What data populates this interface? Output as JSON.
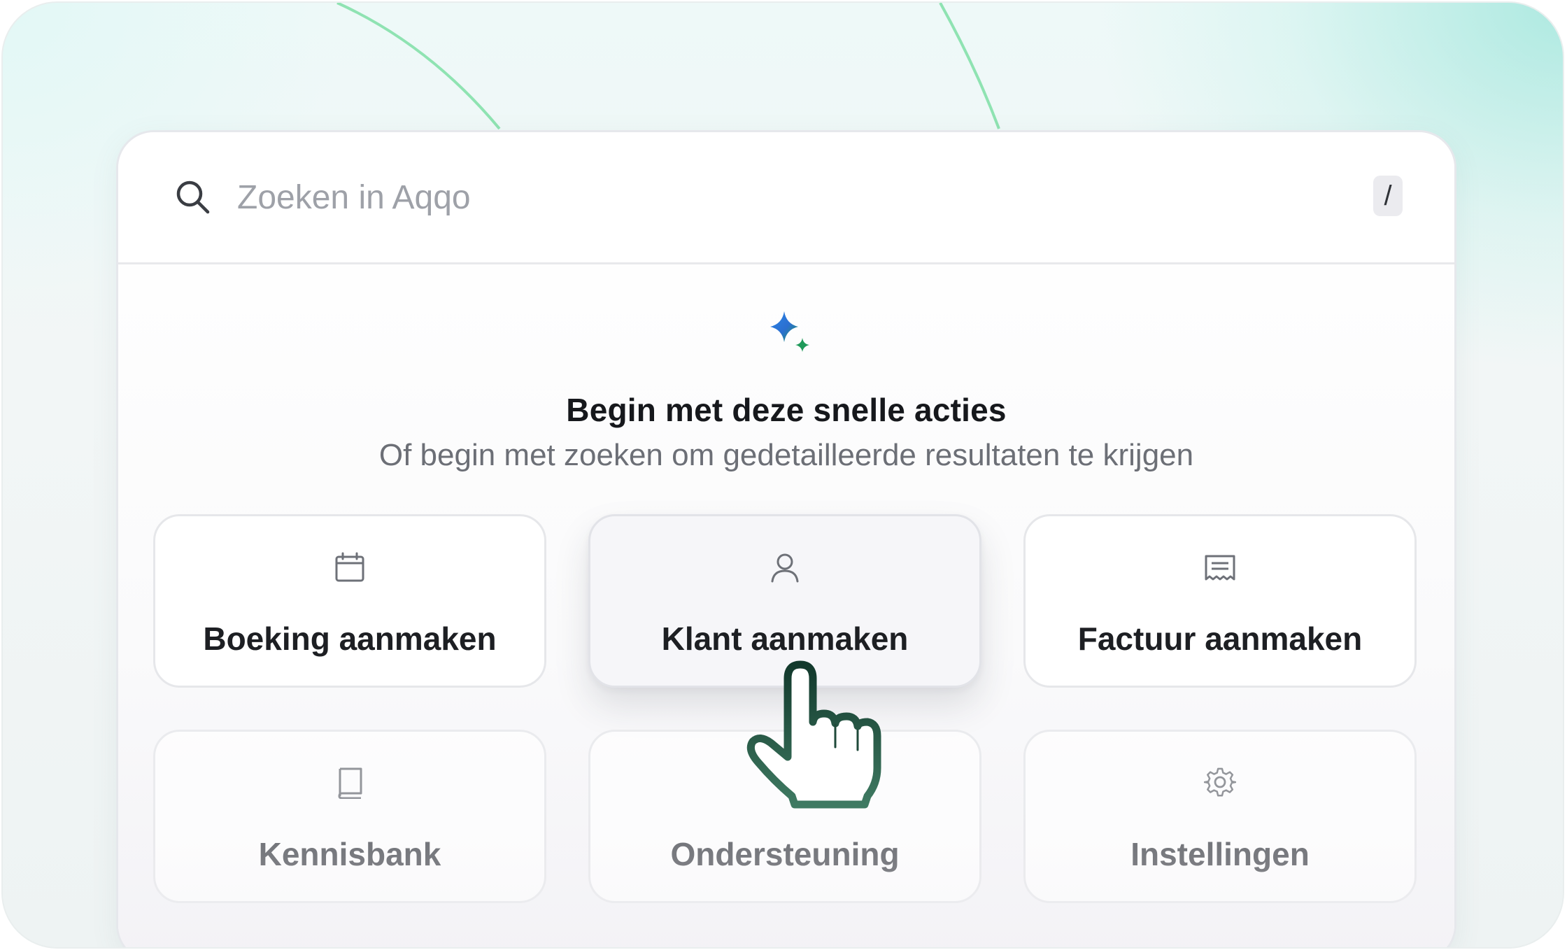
{
  "search": {
    "placeholder": "Zoeken in Aqqo",
    "shortcut": "/"
  },
  "empty_state": {
    "icon": "sparkle-icon",
    "title": "Begin met deze snelle acties",
    "subtitle": "Of begin met zoeken om gedetailleerde resultaten te krijgen"
  },
  "quick_actions": [
    {
      "label": "Boeking aanmaken",
      "icon": "calendar-icon",
      "state": "default"
    },
    {
      "label": "Klant aanmaken",
      "icon": "user-icon",
      "state": "hover"
    },
    {
      "label": "Factuur aanmaken",
      "icon": "receipt-icon",
      "state": "default"
    },
    {
      "label": "Kennisbank",
      "icon": "book-icon",
      "state": "muted"
    },
    {
      "label": "Ondersteuning",
      "icon": "support-icon",
      "state": "muted"
    },
    {
      "label": "Instellingen",
      "icon": "gear-icon",
      "state": "muted"
    }
  ],
  "colors": {
    "accent_green": "#7fdca6",
    "cursor_outline": "#1f4a3a",
    "sparkle_blue": "#2b78d6",
    "sparkle_green": "#1f9a5a"
  }
}
